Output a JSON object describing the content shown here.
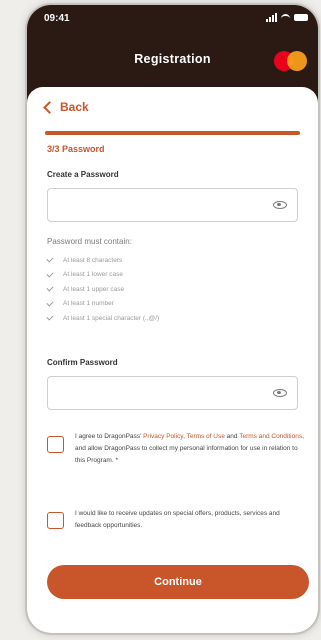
{
  "status": {
    "time": "09:41"
  },
  "header": {
    "title": "Registration",
    "logo": "mastercard-logo"
  },
  "nav": {
    "back_label": "Back"
  },
  "progress": {
    "value": 1.0
  },
  "step_label": "3/3 Password",
  "password": {
    "label": "Create a Password",
    "value": "",
    "toggle_icon": "eye-icon"
  },
  "rules": {
    "title": "Password must contain:",
    "items": [
      "At least 8 characters",
      "At least 1 lower case",
      "At least 1 upper case",
      "At least 1 number",
      "At least 1 special character (.,@/)"
    ]
  },
  "confirm": {
    "label": "Confirm Password",
    "value": "",
    "toggle_icon": "eye-icon"
  },
  "consent_terms": {
    "part1": "I agree to DragonPass' ",
    "privacy_link": "Privacy Policy",
    "comma": ", ",
    "terms_link": "Terms of Use",
    "and": " and ",
    "conditions_link": "Terms and Conditions",
    "part2": ", and allow DragonPass to collect my personal information for use in relation to this Program. *",
    "checked": false
  },
  "consent_updates": {
    "text": "I would like to receive updates on special offers, products, services and feedback opportunities.",
    "checked": false
  },
  "continue_label": "Continue",
  "colors": {
    "accent": "#c8562a",
    "header_bg": "#2b1a14"
  }
}
